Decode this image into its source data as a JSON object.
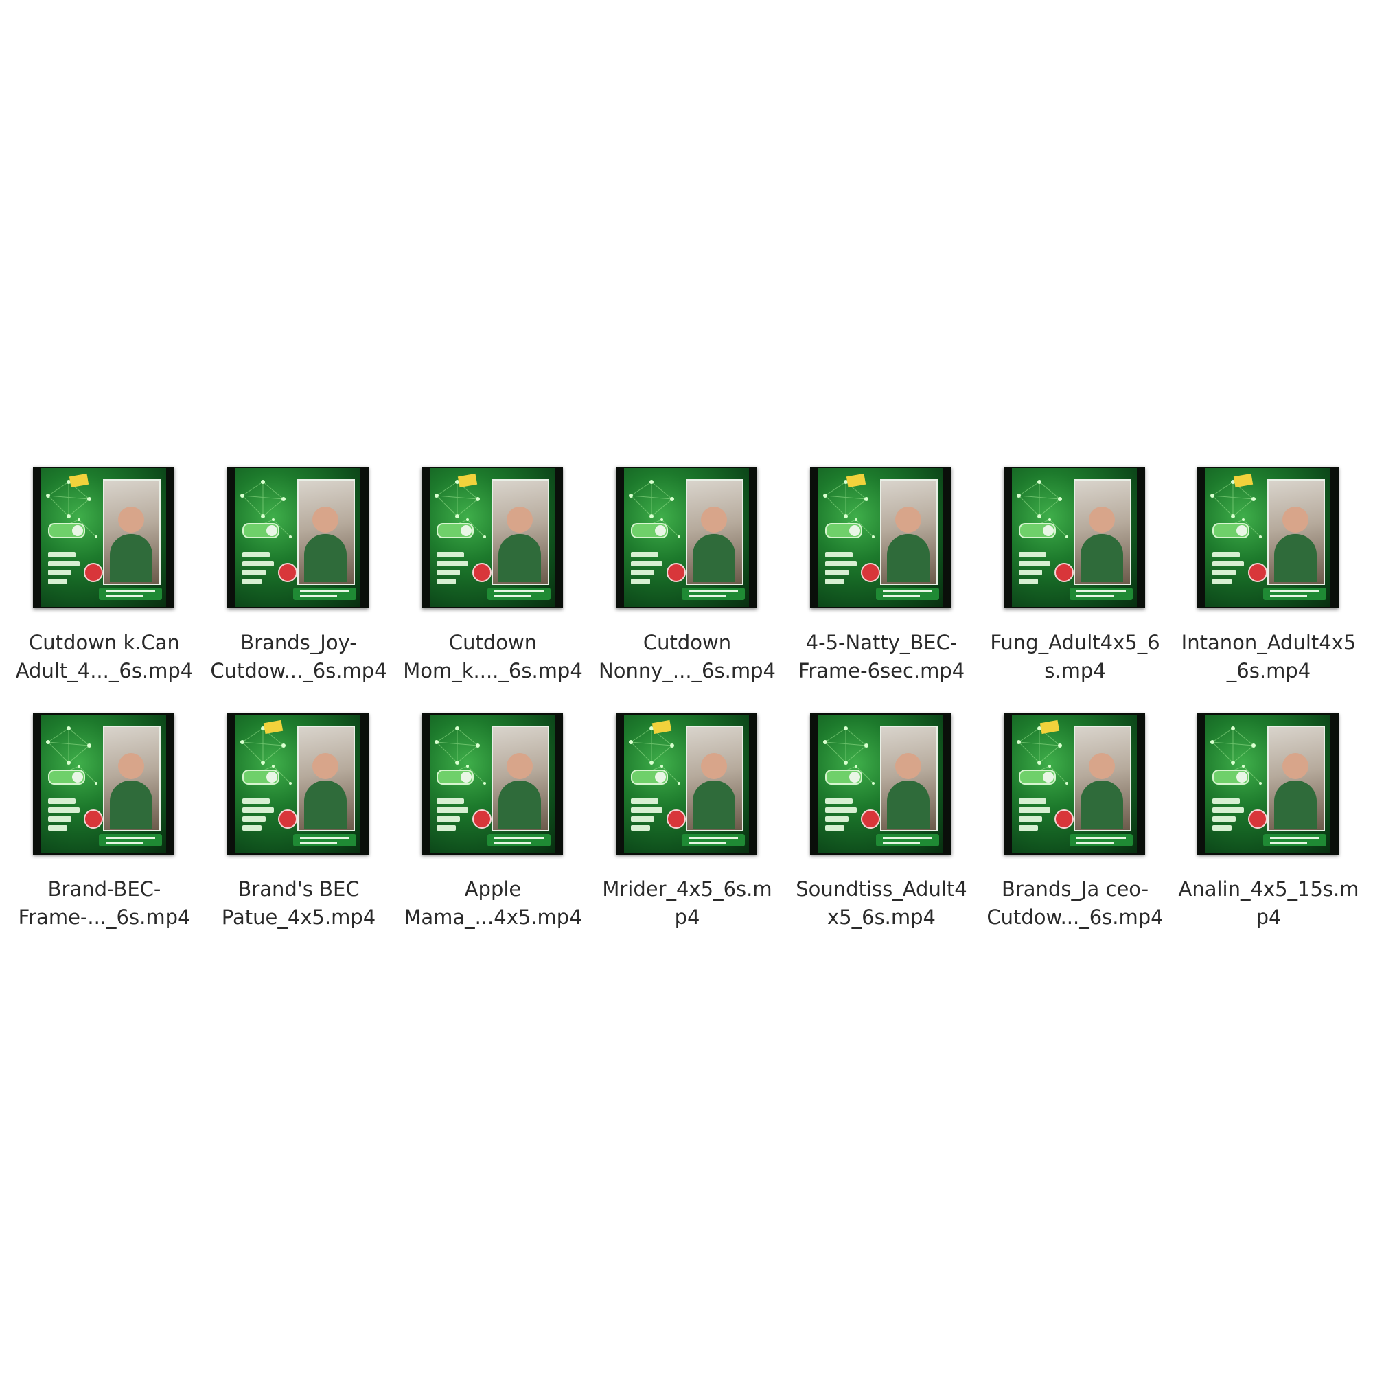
{
  "files": [
    {
      "name_line1": "Cutdown k.Can",
      "name_line2": "Adult_4..._6s.mp4",
      "icon": "video-thumbnail-icon"
    },
    {
      "name_line1": "Brands_Joy-",
      "name_line2": "Cutdow..._6s.mp4",
      "icon": "video-thumbnail-icon"
    },
    {
      "name_line1": "Cutdown",
      "name_line2": "Mom_k...._6s.mp4",
      "icon": "video-thumbnail-icon"
    },
    {
      "name_line1": "Cutdown",
      "name_line2": "Nonny_..._6s.mp4",
      "icon": "video-thumbnail-icon"
    },
    {
      "name_line1": "4-5-Natty_BEC-",
      "name_line2": "Frame-6sec.mp4",
      "icon": "video-thumbnail-icon"
    },
    {
      "name_line1": "Fung_Adult4x5_6",
      "name_line2": "s.mp4",
      "icon": "video-thumbnail-icon"
    },
    {
      "name_line1": "Intanon_Adult4x5",
      "name_line2": "_6s.mp4",
      "icon": "video-thumbnail-icon"
    },
    {
      "name_line1": "Brand-BEC-",
      "name_line2": "Frame-..._6s.mp4",
      "icon": "video-thumbnail-icon"
    },
    {
      "name_line1": "Brand's BEC",
      "name_line2": "Patue_4x5.mp4",
      "icon": "video-thumbnail-icon"
    },
    {
      "name_line1": "Apple",
      "name_line2": "Mama_...4x5.mp4",
      "icon": "video-thumbnail-icon"
    },
    {
      "name_line1": "Mrider_4x5_6s.m",
      "name_line2": "p4",
      "icon": "video-thumbnail-icon"
    },
    {
      "name_line1": "Soundtiss_Adult4",
      "name_line2": "x5_6s.mp4",
      "icon": "video-thumbnail-icon"
    },
    {
      "name_line1": "Brands_Ja ceo-",
      "name_line2": "Cutdow..._6s.mp4",
      "icon": "video-thumbnail-icon"
    },
    {
      "name_line1": "Analin_4x5_15s.m",
      "name_line2": "p4",
      "icon": "video-thumbnail-icon"
    }
  ],
  "colors": {
    "background": "#ffffff",
    "label_text": "#2a2a2a",
    "thumb_green": "#1d7a2c"
  }
}
